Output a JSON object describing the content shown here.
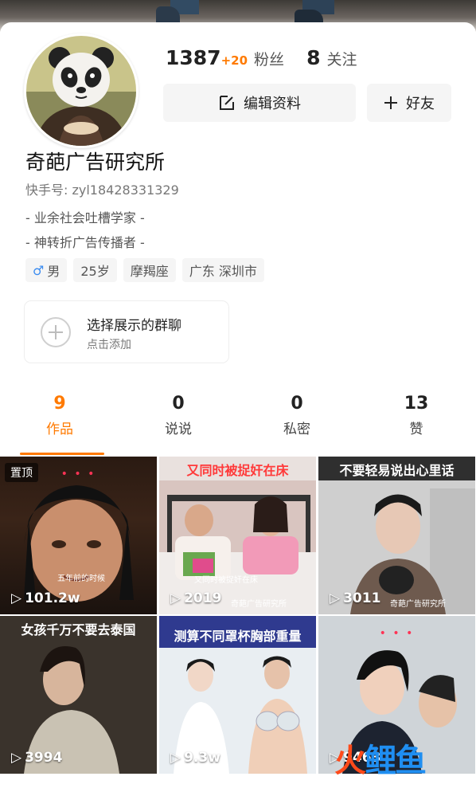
{
  "profile": {
    "fans_count": "1387",
    "fans_delta": "+20",
    "fans_label": "粉丝",
    "following_count": "8",
    "following_label": "关注",
    "edit_label": "编辑资料",
    "friend_label": "好友",
    "name": "奇葩广告研究所",
    "kuaishou_id": "快手号: zyl18428331329",
    "bio": [
      "- 业余社会吐槽学家 -",
      "- 神转折广告传播者 -"
    ],
    "tags": {
      "gender": "男",
      "age": "25岁",
      "zodiac": "摩羯座",
      "location": "广东 深圳市"
    }
  },
  "group_chat": {
    "title": "选择展示的群聊",
    "subtitle": "点击添加"
  },
  "tabs": [
    {
      "count": "9",
      "label": "作品",
      "active": true
    },
    {
      "count": "0",
      "label": "说说"
    },
    {
      "count": "0",
      "label": "私密"
    },
    {
      "count": "13",
      "label": "赞"
    }
  ],
  "videos": [
    {
      "views": "101.2w",
      "pinned": "置顶",
      "subtitle": "五年前的时候",
      "dots": "• • •"
    },
    {
      "views": "2019",
      "caption": "又同时被捉奸在床",
      "subtitle": "又同时被捉奸在床",
      "footer": "奇葩广告研究所"
    },
    {
      "views": "3011",
      "caption": "不要轻易说出心里话",
      "footer": "奇葩广告研究所"
    },
    {
      "views": "3994",
      "caption": "女孩千万不要去泰国"
    },
    {
      "views": "9.3w",
      "caption": "测算不同罩杯胸部重量"
    },
    {
      "views": "9463",
      "dots": "• • •"
    }
  ],
  "watermark": {
    "text1": "火",
    "text2": "鲤鱼"
  },
  "colors": {
    "accent": "#ff7a00",
    "male": "#3b8cf0",
    "caption_red": "#ff3a3a"
  }
}
